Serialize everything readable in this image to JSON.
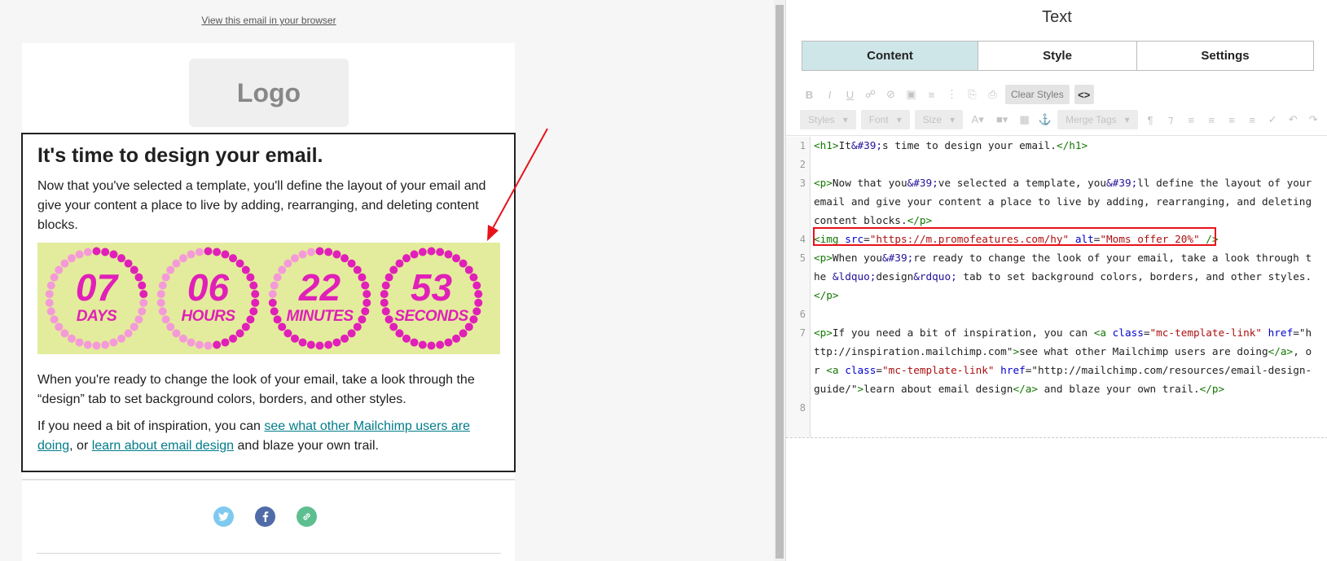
{
  "preview": {
    "view_in_browser": "View this email in your browser",
    "logo_text": "Logo",
    "headline": "It's time to design your email.",
    "para1": "Now that you've selected a template, you'll define the layout of your email and give your content a place to live by adding, rearranging, and deleting content blocks.",
    "para2": "When you're ready to change the look of your email, take a look through the “design” tab to set background colors, borders, and other styles.",
    "para3": {
      "pre": "If you need a bit of inspiration, you can ",
      "link1": "see what other Mailchimp users are doing",
      "mid": ", or ",
      "link2": "learn about email design",
      "post": " and blaze your own trail."
    },
    "countdown": [
      {
        "value": "07",
        "label": "DAYS"
      },
      {
        "value": "06",
        "label": "HOURS"
      },
      {
        "value": "22",
        "label": "MINUTES"
      },
      {
        "value": "53",
        "label": "SECONDS"
      }
    ],
    "social_icons": [
      "twitter-icon",
      "facebook-icon",
      "link-icon"
    ]
  },
  "editor": {
    "title": "Text",
    "tabs": [
      "Content",
      "Style",
      "Settings"
    ],
    "active_tab": "Content",
    "toolbar": {
      "row1_icons": [
        "bold-icon",
        "italic-icon",
        "underline-icon",
        "link-icon",
        "unlink-icon",
        "image-icon",
        "ordered-list-icon",
        "bullet-list-icon",
        "paste-icon",
        "paste-text-icon"
      ],
      "clear_styles": "Clear Styles",
      "source": "<>",
      "styles": "Styles",
      "font": "Font",
      "size": "Size",
      "merge_tags": "Merge Tags",
      "row2_icons": [
        "text-color-icon",
        "highlight-icon",
        "table-icon",
        "anchor-icon",
        "paragraph-icon",
        "rtl-icon",
        "align-left-icon",
        "align-center-icon",
        "align-right-icon",
        "justify-icon",
        "spellcheck-icon",
        "undo-icon",
        "redo-icon"
      ]
    },
    "code_lines": [
      {
        "n": "1",
        "text": "<h1>It&#39;s time to design your email.</h1>"
      },
      {
        "n": "2",
        "text": ""
      },
      {
        "n": "3",
        "text": "<p>Now that you&#39;ve selected a template, you&#39;ll define the layout of your"
      },
      {
        "n": "",
        "text": "email and give your content a place to live by adding, rearranging, and deleting"
      },
      {
        "n": "",
        "text": "content blocks.</p>"
      },
      {
        "n": "4",
        "text": "<img src=\"https://m.promofeatures.com/hy\" alt=\"Moms offer 20%\" />"
      },
      {
        "n": "5",
        "text": "<p>When you&#39;re ready to change the look of your email, take a look through t"
      },
      {
        "n": "",
        "text": "he &ldquo;design&rdquo; tab to set background colors, borders, and other styles."
      },
      {
        "n": "",
        "text": "</p>"
      },
      {
        "n": "6",
        "text": ""
      },
      {
        "n": "7",
        "text": "<p>If you need a bit of inspiration, you can <a class=\"mc-template-link\" href=\"h"
      },
      {
        "n": "",
        "text": "ttp://inspiration.mailchimp.com\">see what other Mailchimp users are doing</a>, o"
      },
      {
        "n": "",
        "text": "r <a class=\"mc-template-link\" href=\"http://mailchimp.com/resources/email-design-"
      },
      {
        "n": "",
        "text": "guide/\">learn about email design</a> and blaze your own trail.</p>"
      },
      {
        "n": "8",
        "text": ""
      }
    ],
    "highlighted_line": "4"
  },
  "colors": {
    "countdown_bg": "#e3ec9c",
    "countdown_text": "#e020b8",
    "ring_light": "#f59ad8",
    "ring_dark": "#e020b8",
    "link": "#007c89",
    "highlight_box": "#e8131a",
    "active_tab": "#cfe6e8"
  }
}
